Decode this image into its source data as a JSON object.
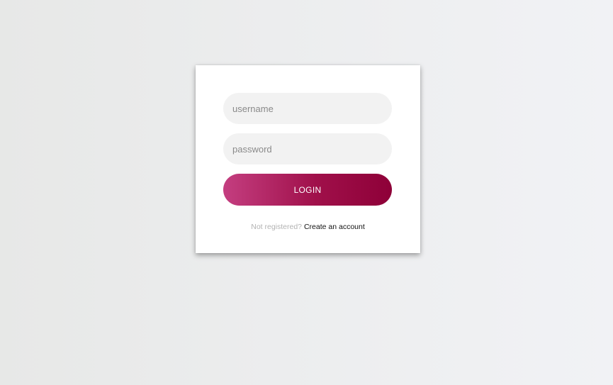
{
  "login_form": {
    "username": {
      "value": "",
      "placeholder": "username"
    },
    "password": {
      "value": "",
      "placeholder": "password"
    },
    "login_label": "LOGIN",
    "register_prompt": "Not registered?",
    "register_link": "Create an account"
  },
  "colors": {
    "background": "#ecedee",
    "card": "#ffffff",
    "input_bg": "#f2f2f2",
    "button_start": "#c43e80",
    "button_end": "#8e0038",
    "muted_text": "#b3b3b3"
  }
}
